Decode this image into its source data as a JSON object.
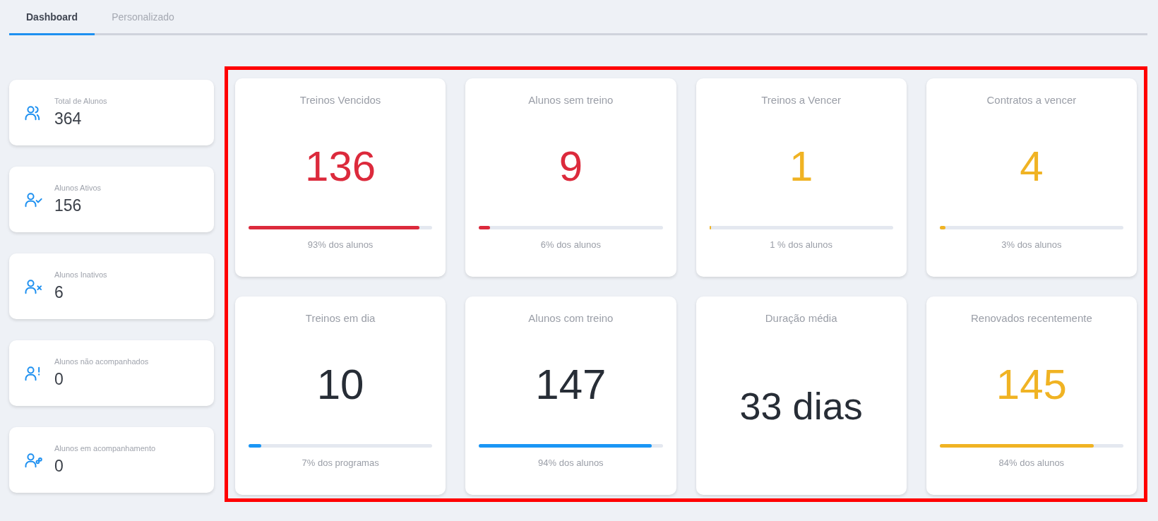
{
  "tabs": [
    {
      "label": "Dashboard",
      "selected": true
    },
    {
      "label": "Personalizado",
      "selected": false
    }
  ],
  "summary_cards": [
    {
      "kind": "group",
      "label": "Total de Alunos",
      "value": "364"
    },
    {
      "kind": "check",
      "label": "Alunos Ativos",
      "value": "156"
    },
    {
      "kind": "cross",
      "label": "Alunos Inativos",
      "value": "6"
    },
    {
      "kind": "alert",
      "label": "Alunos não acompanhados",
      "value": "0"
    },
    {
      "kind": "link",
      "label": "Alunos em acompanhamento",
      "value": "0"
    }
  ],
  "metric_cards": [
    {
      "kind": "progress",
      "title": "Treinos Vencidos",
      "value": "136",
      "color": "#dc2a3c",
      "progress": {
        "level": 0.93,
        "color": "#dc2a3c"
      },
      "caption": "93% dos alunos"
    },
    {
      "kind": "progress",
      "title": "Alunos sem treino",
      "value": "9",
      "color": "#dc2a3c",
      "progress": {
        "level": 0.06,
        "color": "#dc2a3c"
      },
      "caption": "6% dos alunos"
    },
    {
      "kind": "progress",
      "title": "Treinos a Vencer",
      "value": "1",
      "color": "#f0b323",
      "progress": {
        "level": 0.01,
        "color": "#f0b323"
      },
      "caption": "1 % dos alunos"
    },
    {
      "kind": "progress",
      "title": "Contratos a vencer",
      "value": "4",
      "color": "#f0b323",
      "progress": {
        "level": 0.03,
        "color": "#f0b323"
      },
      "caption": "3% dos alunos"
    },
    {
      "kind": "progress",
      "title": "Treinos em dia",
      "value": "10",
      "color": "#272d36",
      "progress": {
        "level": 0.07,
        "color": "#1a96f5"
      },
      "caption": "7% dos programas"
    },
    {
      "kind": "progress",
      "title": "Alunos com treino",
      "value": "147",
      "color": "#272d36",
      "progress": {
        "level": 0.94,
        "color": "#1a96f5"
      },
      "caption": "94% dos alunos"
    },
    {
      "kind": "plain",
      "title": "Duração média",
      "value": "33 dias",
      "color": "#272d36"
    },
    {
      "kind": "progress",
      "title": "Renovados recentemente",
      "value": "145",
      "color": "#f0b323",
      "progress": {
        "level": 0.84,
        "color": "#f0b323"
      },
      "caption": "84% dos alunos"
    }
  ]
}
